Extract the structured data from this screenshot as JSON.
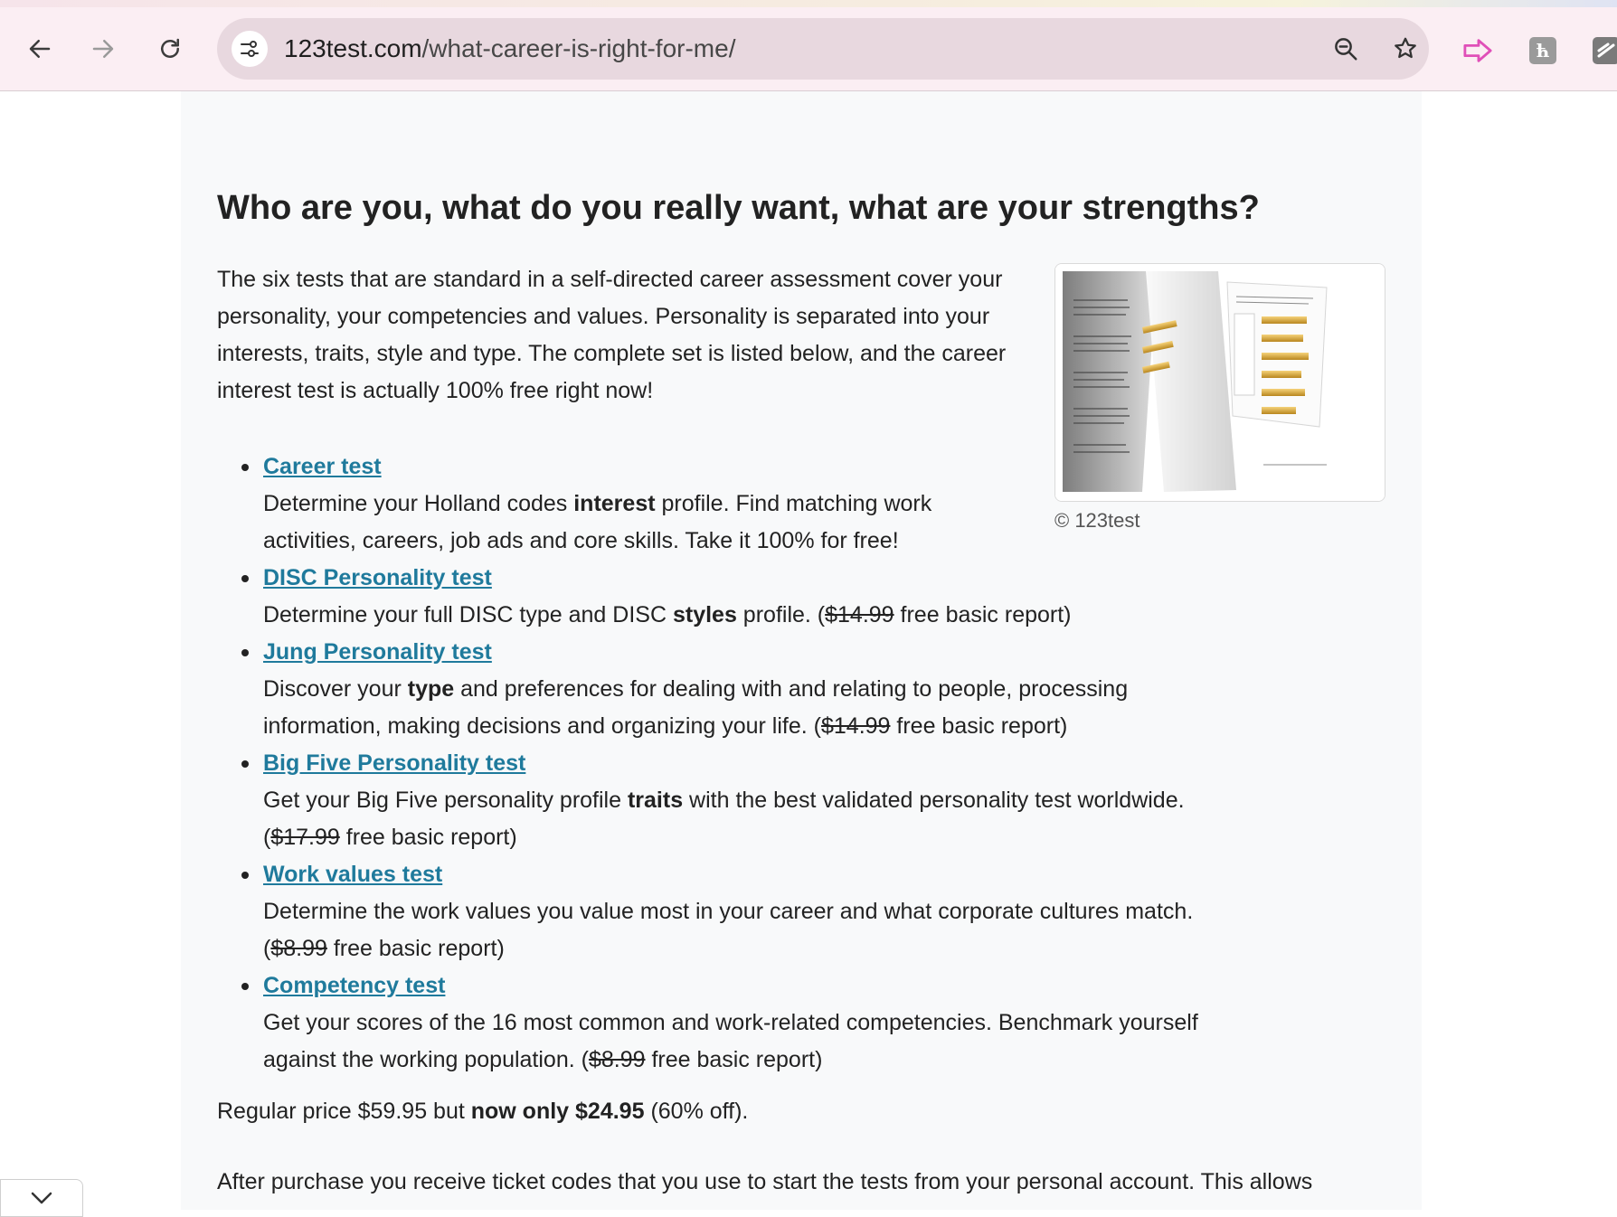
{
  "browser": {
    "url_domain": "123test.com",
    "url_path": "/what-career-is-right-for-me/",
    "icons": [
      "back-icon",
      "forward-icon",
      "reload-icon",
      "site-info-icon",
      "zoom-icon",
      "bookmark-star-icon",
      "extension-arrow-icon",
      "extension-h-icon",
      "extension-slash-icon"
    ]
  },
  "page": {
    "heading": "Who are you, what do you really want, what are your strengths?",
    "intro": "The six tests that are standard in a self-directed career assessment cover your personality, your competencies and values. Personality is separated into your interests, traits, style and type. The complete set is listed below, and the career interest test is actually 100% free right now!",
    "image_caption": "© 123test",
    "tests": [
      {
        "title": "Career test",
        "d1": "Determine your Holland codes ",
        "bold": "interest",
        "d2": " profile. Find matching work activities, careers, job ads and core skills. Take it 100% for free!"
      },
      {
        "title": "DISC Personality test",
        "d1": "Determine your full DISC type and DISC ",
        "bold": "styles",
        "d2": " profile. (",
        "old_price": "$14.99",
        "d3": " free basic report)"
      },
      {
        "title": "Jung Personality test",
        "d1": "Discover your ",
        "bold": "type",
        "d2": " and preferences for dealing with and relating to people, processing information, making decisions and organizing your life. (",
        "old_price": "$14.99",
        "d3": " free basic report)"
      },
      {
        "title": "Big Five Personality test",
        "d1": "Get your Big Five personality profile ",
        "bold": "traits",
        "d2": " with the best validated personality test worldwide. (",
        "old_price": "$17.99",
        "d3": " free basic report)"
      },
      {
        "title": "Work values test",
        "d1": "Determine the work values you value most in your career and what corporate cultures match. (",
        "bold": "",
        "d2": "",
        "old_price": "$8.99",
        "d3": " free basic report)"
      },
      {
        "title": "Competency test",
        "d1": "Get your scores of the 16 most common and work-related competencies. Benchmark yourself against the working population. (",
        "bold": "",
        "d2": "",
        "old_price": "$8.99",
        "d3": " free basic report)"
      }
    ],
    "price_pre": "Regular price $59.95 but ",
    "price_bold": "now only $24.95",
    "price_post": " (60% off).",
    "after_text": "After purchase you receive ticket codes that you use to start the tests from your personal account. This allows"
  },
  "colors": {
    "link": "#1f7a9c",
    "text": "#222222",
    "content_bg": "#f8f9fa",
    "toolbar_bg": "#fbeef3",
    "omnibox_bg": "#e8d8df"
  }
}
